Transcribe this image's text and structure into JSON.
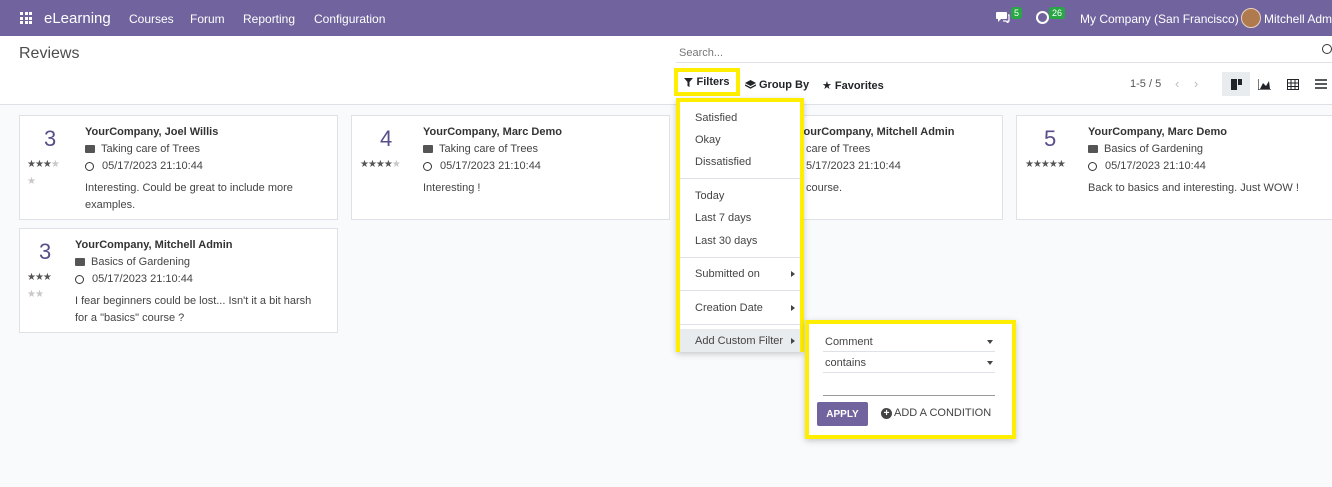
{
  "navbar": {
    "brand": "eLearning",
    "menu": [
      "Courses",
      "Forum",
      "Reporting",
      "Configuration"
    ],
    "messages_count": "5",
    "activities_count": "26",
    "company": "My Company (San Francisco)",
    "user": "Mitchell Adm"
  },
  "control_panel": {
    "title": "Reviews",
    "search_placeholder": "Search...",
    "filters_label": "Filters",
    "group_by_label": "Group By",
    "favorites_label": "Favorites",
    "pager": "1-5 / 5"
  },
  "cards": [
    {
      "rating": "3",
      "stars": 3,
      "author": "YourCompany, Joel Willis",
      "course": "Taking care of Trees",
      "date": "05/17/2023 21:10:44",
      "comment_1": "Interesting. Could be great to include more",
      "comment_2": "examples."
    },
    {
      "rating": "4",
      "stars": 4,
      "author": "YourCompany, Marc Demo",
      "course": "Taking care of Trees",
      "date": "05/17/2023 21:10:44",
      "comment_1": "Interesting !",
      "comment_2": ""
    },
    {
      "rating": "",
      "stars": 0,
      "author": "YourCompany, Mitchell Admin",
      "course": "care of Trees",
      "date": "5/17/2023 21:10:44",
      "comment_1": "course.",
      "comment_2": ""
    },
    {
      "rating": "5",
      "stars": 5,
      "author": "YourCompany, Marc Demo",
      "course": "Basics of Gardening",
      "date": "05/17/2023 21:10:44",
      "comment_1": "Back to basics and interesting. Just WOW !",
      "comment_2": ""
    },
    {
      "rating": "3",
      "stars": 3,
      "author": "YourCompany, Mitchell Admin",
      "course": "Basics of Gardening",
      "date": "05/17/2023 21:10:44",
      "comment_1": "I fear beginners could be lost... Isn't it a bit harsh",
      "comment_2": "for a \"basics\" course ?"
    }
  ],
  "filters_menu": {
    "satisfied": "Satisfied",
    "okay": "Okay",
    "dissatisfied": "Dissatisfied",
    "today": "Today",
    "last_7": "Last 7 days",
    "last_30": "Last 30 days",
    "submitted_on": "Submitted on",
    "creation_date": "Creation Date",
    "add_custom": "Add Custom Filter"
  },
  "custom_filter": {
    "field": "Comment",
    "operator": "contains",
    "apply_label": "APPLY",
    "add_condition_label": "ADD A CONDITION"
  },
  "colors": {
    "navbar": "#71639e",
    "highlight": "#ffee00",
    "badge": "#28a745"
  }
}
